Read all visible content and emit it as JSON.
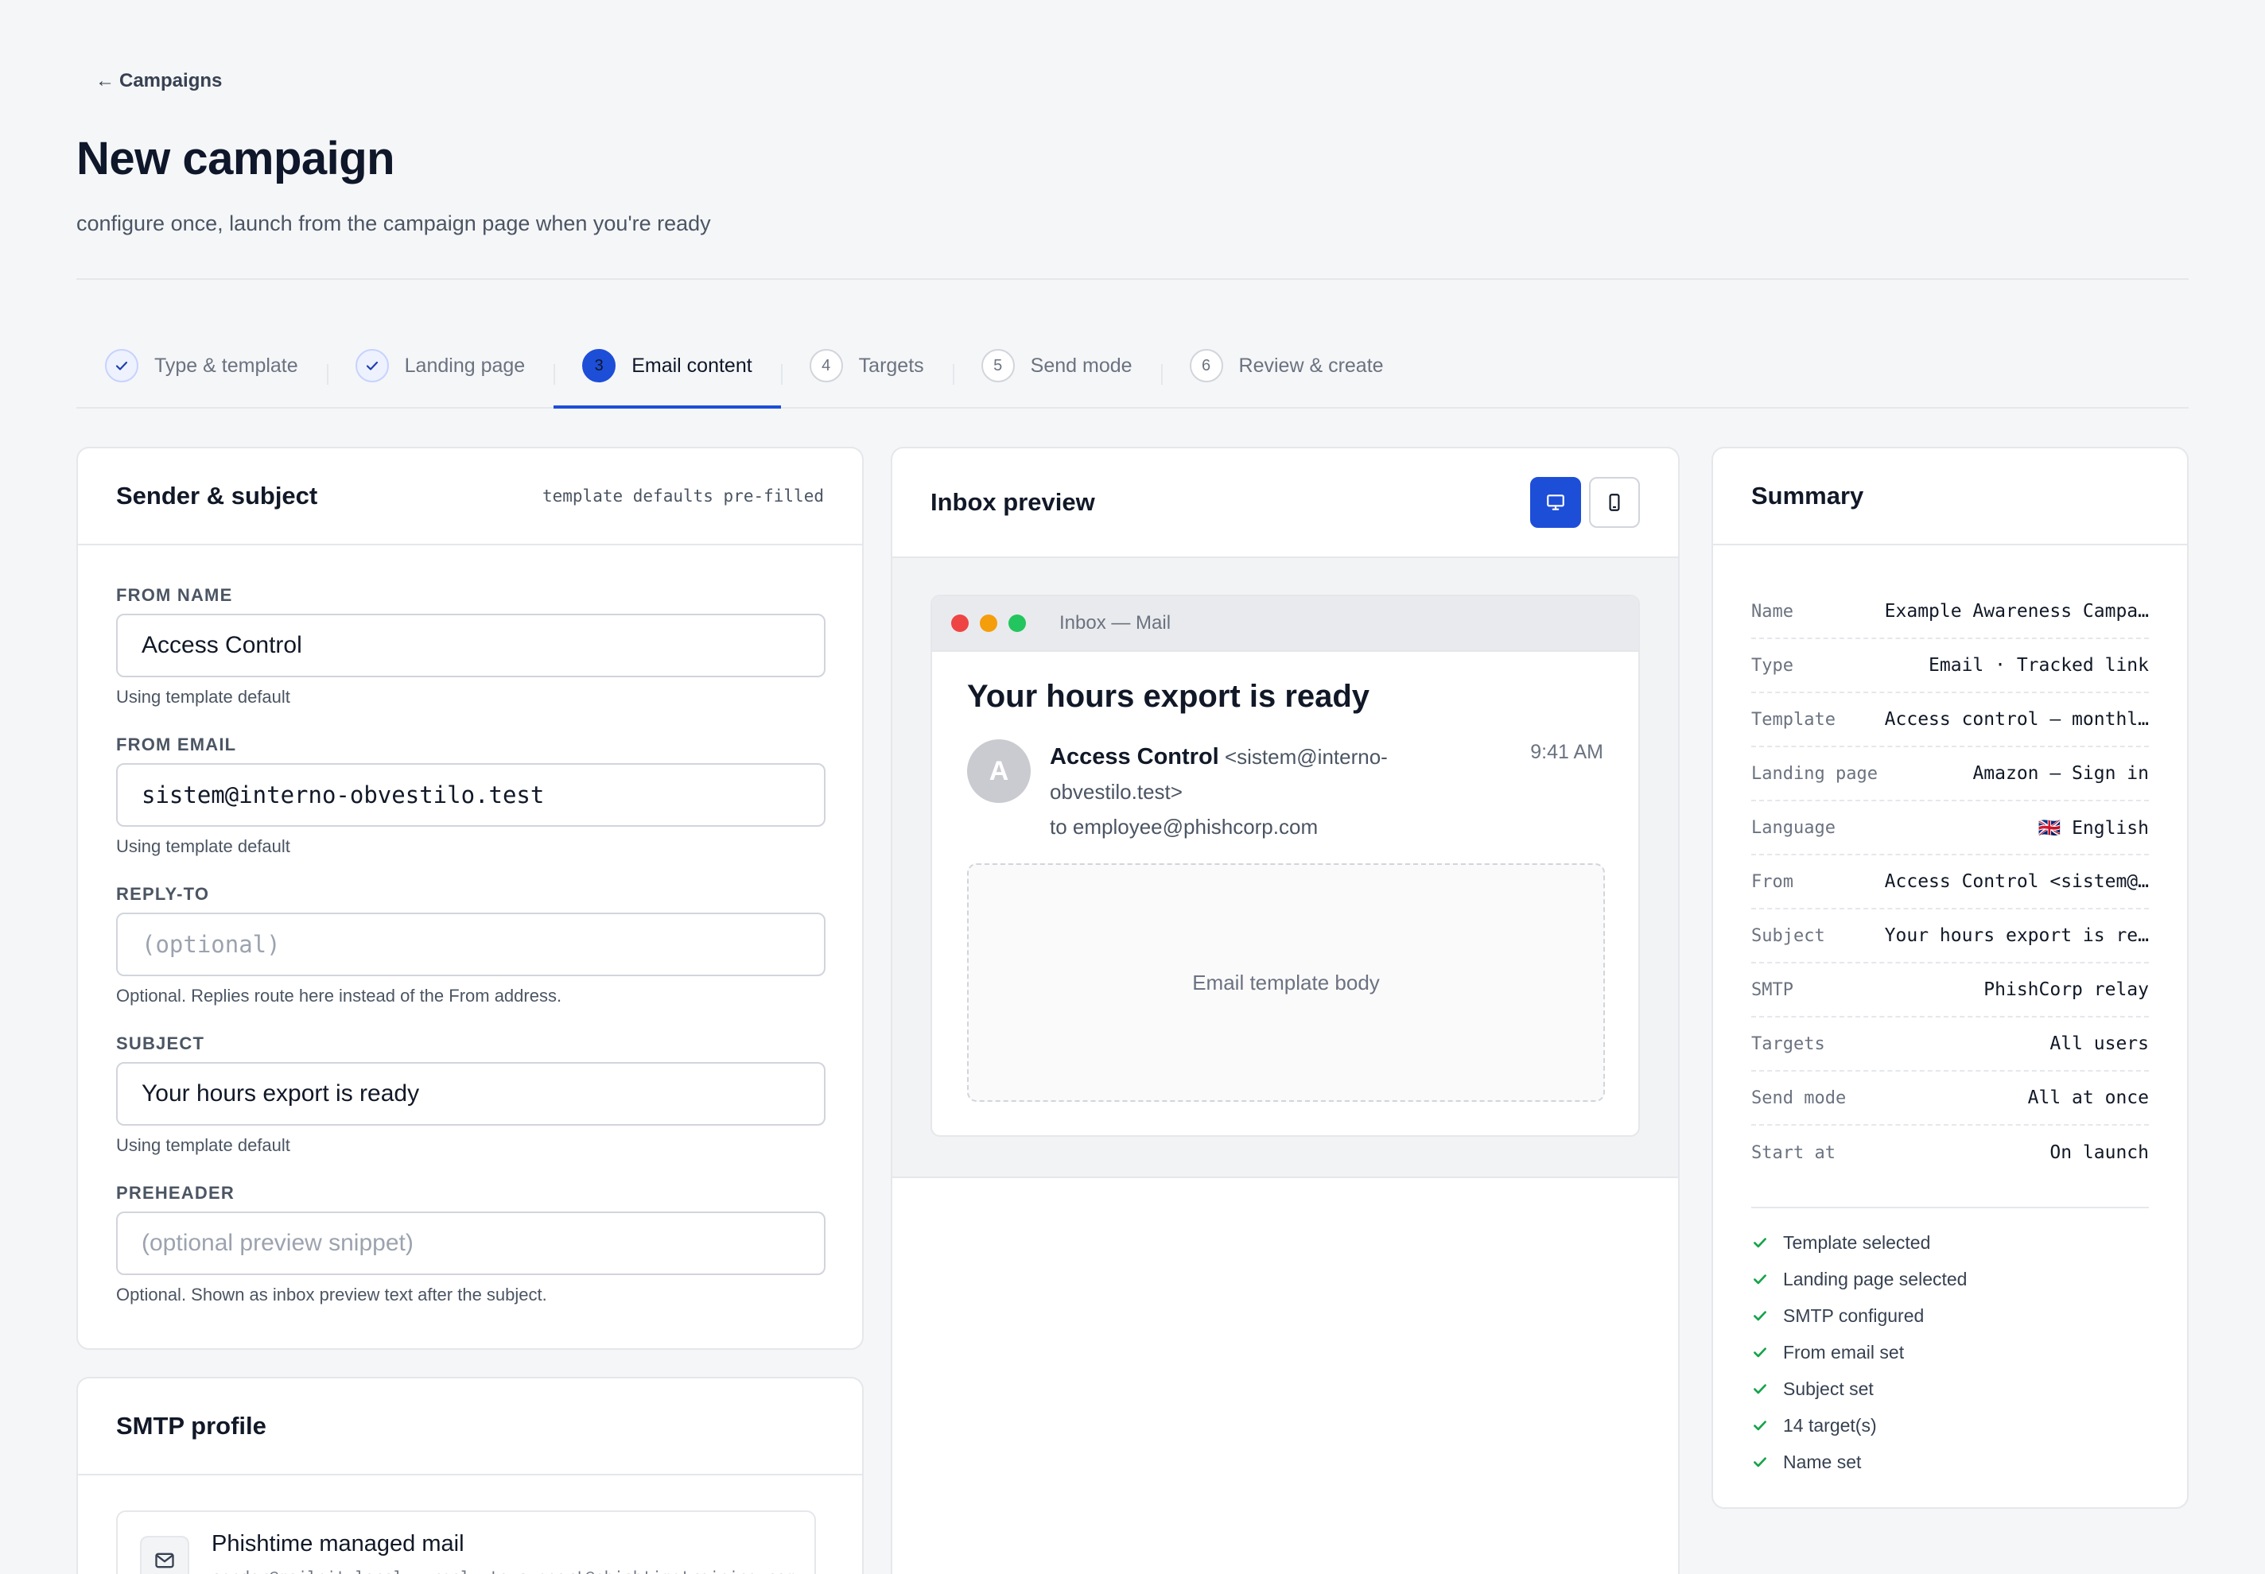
{
  "header": {
    "back_label": "Campaigns",
    "title": "New campaign",
    "subtitle": "configure once, launch from the campaign page when you're ready"
  },
  "stepper": {
    "steps": [
      {
        "number": "1",
        "label": "Type & template",
        "state": "done"
      },
      {
        "number": "2",
        "label": "Landing page",
        "state": "done"
      },
      {
        "number": "3",
        "label": "Email content",
        "state": "active"
      },
      {
        "number": "4",
        "label": "Targets",
        "state": "pending"
      },
      {
        "number": "5",
        "label": "Send mode",
        "state": "pending"
      },
      {
        "number": "6",
        "label": "Review & create",
        "state": "pending"
      }
    ]
  },
  "sender_card": {
    "title": "Sender & subject",
    "note": "template defaults pre-filled",
    "fields": {
      "from_name": {
        "label": "FROM NAME",
        "value": "Access Control",
        "help": "Using template default"
      },
      "from_email": {
        "label": "FROM EMAIL",
        "value": "sistem@interno-obvestilo.test",
        "help": "Using template default"
      },
      "reply_to": {
        "label": "REPLY-TO",
        "placeholder": "(optional)",
        "help": "Optional. Replies route here instead of the From address."
      },
      "subject": {
        "label": "SUBJECT",
        "value": "Your hours export is ready",
        "help": "Using template default"
      },
      "preheader": {
        "label": "PREHEADER",
        "placeholder": "(optional preview snippet)",
        "help": "Optional. Shown as inbox preview text after the subject."
      }
    }
  },
  "smtp_card": {
    "title": "SMTP profile",
    "selected": {
      "name": "Phishtime managed mail",
      "detail": "sender@mailpit.local · reply-to support@phishtimetraining.com"
    }
  },
  "preview_card": {
    "title": "Inbox preview",
    "window_title": "Inbox — Mail",
    "subject": "Your hours export is ready",
    "avatar_initial": "A",
    "sender_name": "Access Control",
    "sender_address": "<sistem@interno-obvestilo.test>",
    "recipient": "to employee@phishcorp.com",
    "time": "9:41 AM",
    "body_placeholder": "Email template body",
    "view_mode": "desktop"
  },
  "summary_card": {
    "title": "Summary",
    "rows": [
      {
        "key": "Name",
        "value": "Example Awareness Campa…"
      },
      {
        "key": "Type",
        "value": "Email · Tracked link"
      },
      {
        "key": "Template",
        "value": "Access control — monthl…"
      },
      {
        "key": "Landing page",
        "value": "Amazon — Sign in"
      },
      {
        "key": "Language",
        "value": "🇬🇧 English"
      },
      {
        "key": "From",
        "value": "Access Control <sistem@…"
      },
      {
        "key": "Subject",
        "value": "Your hours export is re…"
      },
      {
        "key": "SMTP",
        "value": "PhishCorp relay"
      },
      {
        "key": "Targets",
        "value": "All users"
      },
      {
        "key": "Send mode",
        "value": "All at once"
      },
      {
        "key": "Start at",
        "value": "On launch"
      }
    ],
    "checklist": [
      "Template selected",
      "Landing page selected",
      "SMTP configured",
      "From email set",
      "Subject set",
      "14 target(s)",
      "Name set"
    ]
  },
  "colors": {
    "accent": "#1d4ed8",
    "success": "#16a34a",
    "mac_red": "#ef4444",
    "mac_yellow": "#f59e0b",
    "mac_green": "#22c55e"
  }
}
